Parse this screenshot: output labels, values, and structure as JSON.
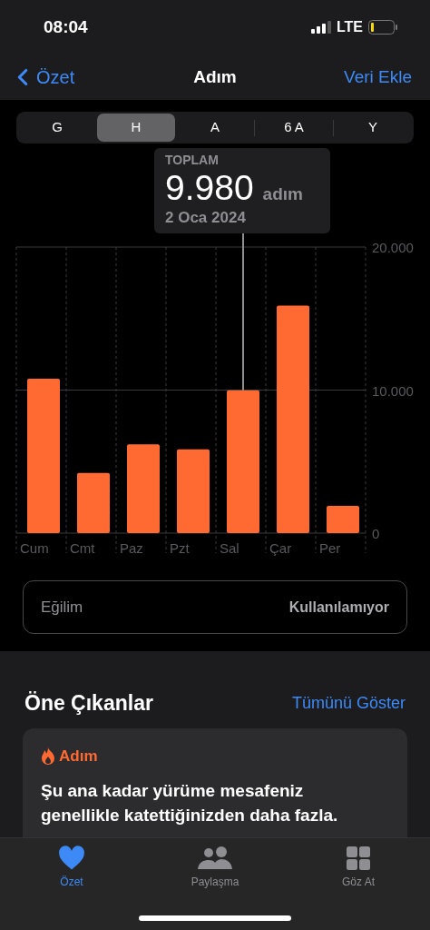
{
  "status_bar": {
    "time": "08:04",
    "network": "LTE"
  },
  "nav": {
    "back": "Özet",
    "title": "Adım",
    "action": "Veri Ekle"
  },
  "segments": [
    {
      "label": "G",
      "selected": false
    },
    {
      "label": "H",
      "selected": true
    },
    {
      "label": "A",
      "selected": false
    },
    {
      "label": "6 A",
      "selected": false
    },
    {
      "label": "Y",
      "selected": false
    }
  ],
  "tooltip": {
    "label": "TOPLAM",
    "value": "9.980",
    "unit": "adım",
    "date": "2 Oca 2024"
  },
  "chart_data": {
    "type": "bar",
    "categories": [
      "Cum",
      "Cmt",
      "Paz",
      "Pzt",
      "Sal",
      "Çar",
      "Per"
    ],
    "series": [
      {
        "color": "#ff6a33",
        "values": [
          10800,
          4200,
          6200,
          5850,
          9980,
          15900,
          1900
        ]
      }
    ],
    "ylim": [
      0,
      20000
    ],
    "yticks": [
      {
        "value": 0,
        "label": "0"
      },
      {
        "value": 10000,
        "label": "10.000"
      },
      {
        "value": 20000,
        "label": "20.000"
      }
    ],
    "annotations": [
      {
        "x": "Sal"
      }
    ]
  },
  "trend": {
    "label": "Eğilim",
    "value": "Kullanılamıyor"
  },
  "highlights": {
    "title": "Öne Çıkanlar",
    "link": "Tümünü Göster",
    "card": {
      "category": "Adım",
      "text": "Şu ana kadar yürüme mesafeniz genellikle katettiğinizden daha fazla."
    }
  },
  "tab_bar": [
    {
      "kind": "heart",
      "label": "Özet",
      "selected": true
    },
    {
      "kind": "people",
      "label": "Paylaşma",
      "selected": false
    },
    {
      "kind": "grid",
      "label": "Göz At",
      "selected": false
    }
  ]
}
